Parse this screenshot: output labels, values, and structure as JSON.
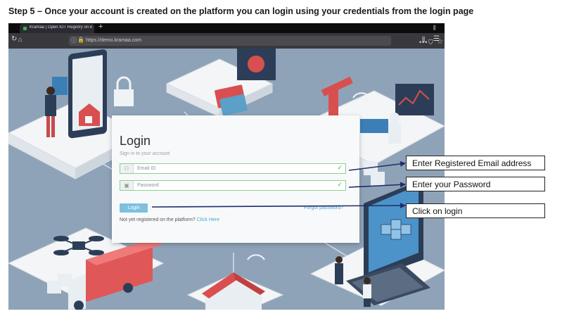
{
  "heading": "Step 5 – Once your account is created on the platform you can login using your credentials from the login page",
  "browser": {
    "tab_title": "Kramaa | Open IOT Registry on",
    "tab_close": "×",
    "new_tab": "+",
    "url": "https://demo.kramaa.com",
    "icons": [
      "back-icon",
      "home-icon",
      "info-icon",
      "lock-icon",
      "more-icon",
      "pocket-icon",
      "star-icon",
      "library-icon",
      "menu-icon"
    ]
  },
  "login": {
    "title": "Login",
    "subtitle": "Sign in to your account",
    "email_placeholder": "Email ID",
    "password_placeholder": "Password",
    "button": "Login",
    "forgot": "Forgot password?",
    "not_registered": "Not yet registered on the platform?",
    "click_here": "Click Here"
  },
  "callouts": [
    "Enter Registered Email address",
    "Enter your Password",
    "Click on login"
  ],
  "colors": {
    "annotation_arrow": "#1f2d6b",
    "field_border_valid": "#8fcf8f",
    "login_button": "#7ec0e0",
    "link": "#4fa3d8"
  }
}
